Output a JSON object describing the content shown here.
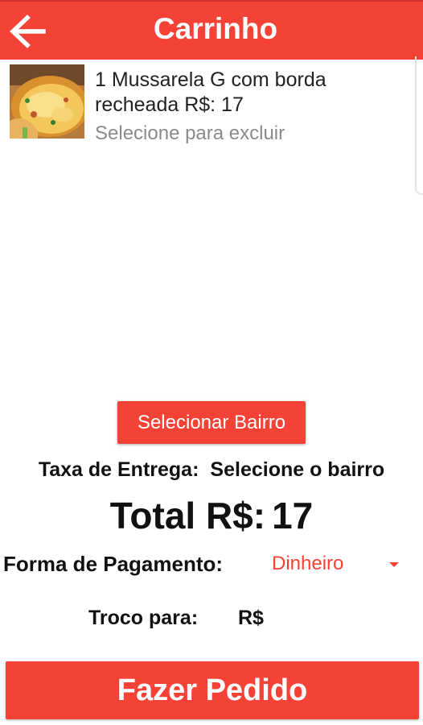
{
  "appbar": {
    "title": "Carrinho",
    "back_icon": "arrow-left-icon"
  },
  "cart": {
    "items": [
      {
        "title": "1 Mussarela G com borda recheada R$: 17",
        "hint": "Selecione para excluir",
        "image": "pizza-photo"
      }
    ]
  },
  "delivery": {
    "select_button": "Selecionar Bairro",
    "fee_label": "Taxa de Entrega:",
    "fee_value": "Selecione o bairro"
  },
  "total": {
    "label": "Total R$:",
    "value": "17"
  },
  "payment": {
    "label": "Forma de Pagamento:",
    "selected": "Dinheiro"
  },
  "change": {
    "label": "Troco para:",
    "prefix": "R$",
    "value": ""
  },
  "order_button": "Fazer Pedido",
  "colors": {
    "accent": "#F44336",
    "hint_text": "#8a8a8a"
  }
}
